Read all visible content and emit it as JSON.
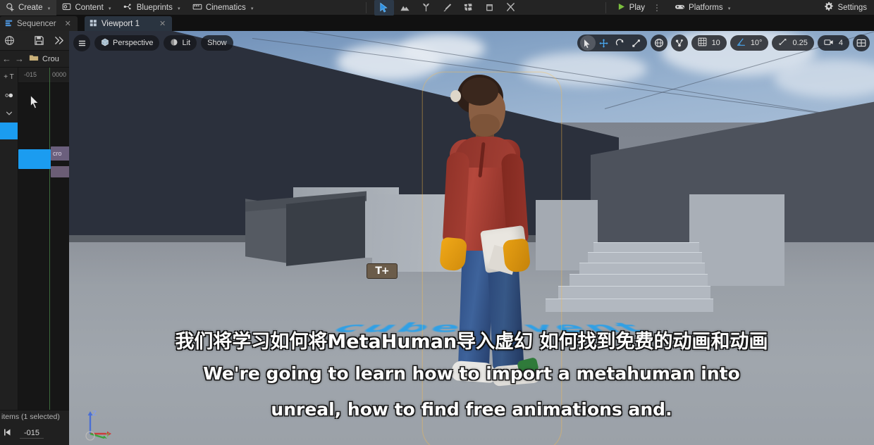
{
  "app": {
    "toolbar": {
      "items": [
        {
          "label": "Create",
          "icon": "create-icon",
          "caret": true
        },
        {
          "label": "Content",
          "icon": "content-icon",
          "caret": true
        },
        {
          "label": "Blueprints",
          "icon": "blueprints-icon",
          "caret": true
        },
        {
          "label": "Cinematics",
          "icon": "cinematics-icon",
          "caret": true
        }
      ],
      "modes": [
        {
          "name": "select-mode-icon",
          "active": true
        },
        {
          "name": "landscape-mode-icon",
          "active": false
        },
        {
          "name": "foliage-mode-icon",
          "active": false
        },
        {
          "name": "mesh-paint-mode-icon",
          "active": false
        },
        {
          "name": "fracture-mode-icon",
          "active": false
        },
        {
          "name": "brush-edit-mode-icon",
          "active": false
        },
        {
          "name": "animation-mode-icon",
          "active": false
        }
      ],
      "play_label": "Play",
      "platforms_label": "Platforms",
      "settings_label": "Settings",
      "kebab": "⋮"
    }
  },
  "tabs": [
    {
      "label": "Sequencer",
      "icon": "sequencer-icon",
      "active": false,
      "close": "✕"
    },
    {
      "label": "Viewport 1",
      "icon": "viewport-icon",
      "active": true,
      "close": "✕"
    }
  ],
  "sequencer": {
    "breadcrumb_label": "Crou",
    "breadcrumb_icon": "folder-icon",
    "save_icon": "save-icon",
    "more_icon": "double-chevron-right-icon",
    "globe_icon": "world-icon",
    "back_icon": "arrow-left-icon",
    "forward_icon": "arrow-right-icon",
    "add_track_label": "+ T",
    "time_ticks": [
      {
        "label": "-015",
        "x": 14
      },
      {
        "label": "0000",
        "x": 50
      }
    ],
    "outliner_rows": [
      {
        "icon": "plus-track-icon"
      },
      {
        "icon": "key-circle-icon"
      },
      {
        "icon": "chevron-down-icon"
      }
    ],
    "clip_label": "cro",
    "status_text": "items (1 selected)",
    "current_frame": "-015",
    "step_back_icon": "step-back-icon"
  },
  "viewport": {
    "menu_icon": "hamburger-menu-icon",
    "camera_label": "Perspective",
    "camera_icon": "cube-icon",
    "viewmode_label": "Lit",
    "viewmode_icon": "lit-sphere-icon",
    "show_label": "Show",
    "transform_tools": [
      {
        "name": "select-tool-icon",
        "active": true
      },
      {
        "name": "move-tool-icon",
        "active": false
      },
      {
        "name": "rotate-tool-icon",
        "active": false
      },
      {
        "name": "scale-tool-icon",
        "active": false
      }
    ],
    "coord_system_icon": "world-coords-icon",
    "surface_snap_icon": "surface-snap-icon",
    "grid_snap": {
      "icon": "grid-snap-icon",
      "value": "10"
    },
    "angle_snap": {
      "icon": "angle-snap-icon",
      "value": "10°"
    },
    "scale_snap": {
      "icon": "scale-snap-icon",
      "value": "0.25"
    },
    "camera_speed": {
      "icon": "camera-icon",
      "value": "4"
    },
    "layout_icon": "viewport-layout-icon",
    "floor_decal_text": "cubeyevent",
    "text_badge_label": "T+",
    "axis_gizmo": {
      "x": "X",
      "y": "Y",
      "z": "Z"
    }
  },
  "subtitles": {
    "chinese": "我们将学习如何将MetaHuman导入虚幻 如何找到免费的动画和动画",
    "english_line1": "We're going to learn how to import a metahuman into",
    "english_line2": "unreal, how to find free animations and."
  },
  "colors": {
    "accent_blue": "#1b9cf0",
    "play_green": "#7bbf3e",
    "panel_bg": "#1b1b1b",
    "toolbar_bg": "#242424",
    "tab_active": "#2a3440"
  }
}
